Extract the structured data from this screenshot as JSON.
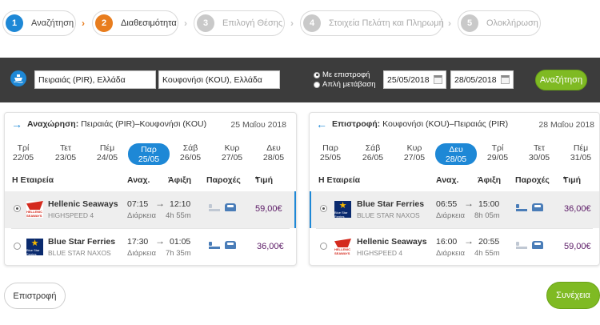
{
  "steps": [
    {
      "num": "1",
      "label": "Αναζήτηση"
    },
    {
      "num": "2",
      "label": "Διαθεσιμότητα"
    },
    {
      "num": "3",
      "label": "Επιλογή Θέσης"
    },
    {
      "num": "4",
      "label": "Στοιχεία Πελάτη και Πληρωμή"
    },
    {
      "num": "5",
      "label": "Ολοκλήρωση"
    }
  ],
  "search": {
    "from": "Πειραιάς (PIR), Ελλάδα",
    "to": "Κουφονήσι (KOU), Ελλάδα",
    "radio_return": "Με επιστροφή",
    "radio_oneway": "Απλή μετάβαση",
    "date_depart": "25/05/2018",
    "date_return": "28/05/2018",
    "button": "Αναζήτηση"
  },
  "outbound": {
    "title_bold": "Αναχώρηση:",
    "title_route": "Πειραιάς (PIR)–Κουφονήσι (KOU)",
    "date": "25 Μαΐου 2018",
    "days": [
      {
        "d": "Τρί",
        "n": "22/05"
      },
      {
        "d": "Τετ",
        "n": "23/05"
      },
      {
        "d": "Πέμ",
        "n": "24/05"
      },
      {
        "d": "Παρ",
        "n": "25/05"
      },
      {
        "d": "Σάβ",
        "n": "26/05"
      },
      {
        "d": "Κυρ",
        "n": "27/05"
      },
      {
        "d": "Δευ",
        "n": "28/05"
      }
    ],
    "cols": {
      "company": "Η Εταιρεία",
      "dep": "Αναχ.",
      "arr": "Άφιξη",
      "amen": "Παροχές",
      "price": "Τιμή"
    },
    "rows": [
      {
        "company": "Hellenic Seaways",
        "ship": "HIGHSPEED 4",
        "dep": "07:15",
        "arr": "12:10",
        "dur_label": "Διάρκεια",
        "dur": "4h 55m",
        "price": "59,00€",
        "logo_text": "HELLENIC SEAWAYS"
      },
      {
        "company": "Blue Star Ferries",
        "ship": "BLUE STAR NAXOS",
        "dep": "17:30",
        "arr": "01:05",
        "dur_label": "Διάρκεια",
        "dur": "7h 35m",
        "price": "36,00€",
        "logo_text": "Blue Star Ferries"
      }
    ]
  },
  "inbound": {
    "title_bold": "Επιστροφή:",
    "title_route": "Κουφονήσι (KOU)–Πειραιάς (PIR)",
    "date": "28 Μαΐου 2018",
    "days": [
      {
        "d": "Παρ",
        "n": "25/05"
      },
      {
        "d": "Σάβ",
        "n": "26/05"
      },
      {
        "d": "Κυρ",
        "n": "27/05"
      },
      {
        "d": "Δευ",
        "n": "28/05"
      },
      {
        "d": "Τρί",
        "n": "29/05"
      },
      {
        "d": "Τετ",
        "n": "30/05"
      },
      {
        "d": "Πέμ",
        "n": "31/05"
      }
    ],
    "cols": {
      "company": "Η Εταιρεία",
      "dep": "Αναχ.",
      "arr": "Άφιξη",
      "amen": "Παροχές",
      "price": "Τιμή"
    },
    "rows": [
      {
        "company": "Blue Star Ferries",
        "ship": "BLUE STAR NAXOS",
        "dep": "06:55",
        "arr": "15:00",
        "dur_label": "Διάρκεια",
        "dur": "8h 05m",
        "price": "36,00€",
        "logo_text": "Blue Star Ferries"
      },
      {
        "company": "Hellenic Seaways",
        "ship": "HIGHSPEED 4",
        "dep": "16:00",
        "arr": "20:55",
        "dur_label": "Διάρκεια",
        "dur": "4h 55m",
        "price": "59,00€",
        "logo_text": "HELLENIC SEAWAYS"
      }
    ]
  },
  "buttons": {
    "back": "Επιστροφή",
    "next": "Συνέχεια"
  },
  "colors": {
    "accent_blue": "#1e88d6",
    "active_step": "#e87d1e",
    "green": "#7fba23",
    "price": "#5b1a66"
  }
}
